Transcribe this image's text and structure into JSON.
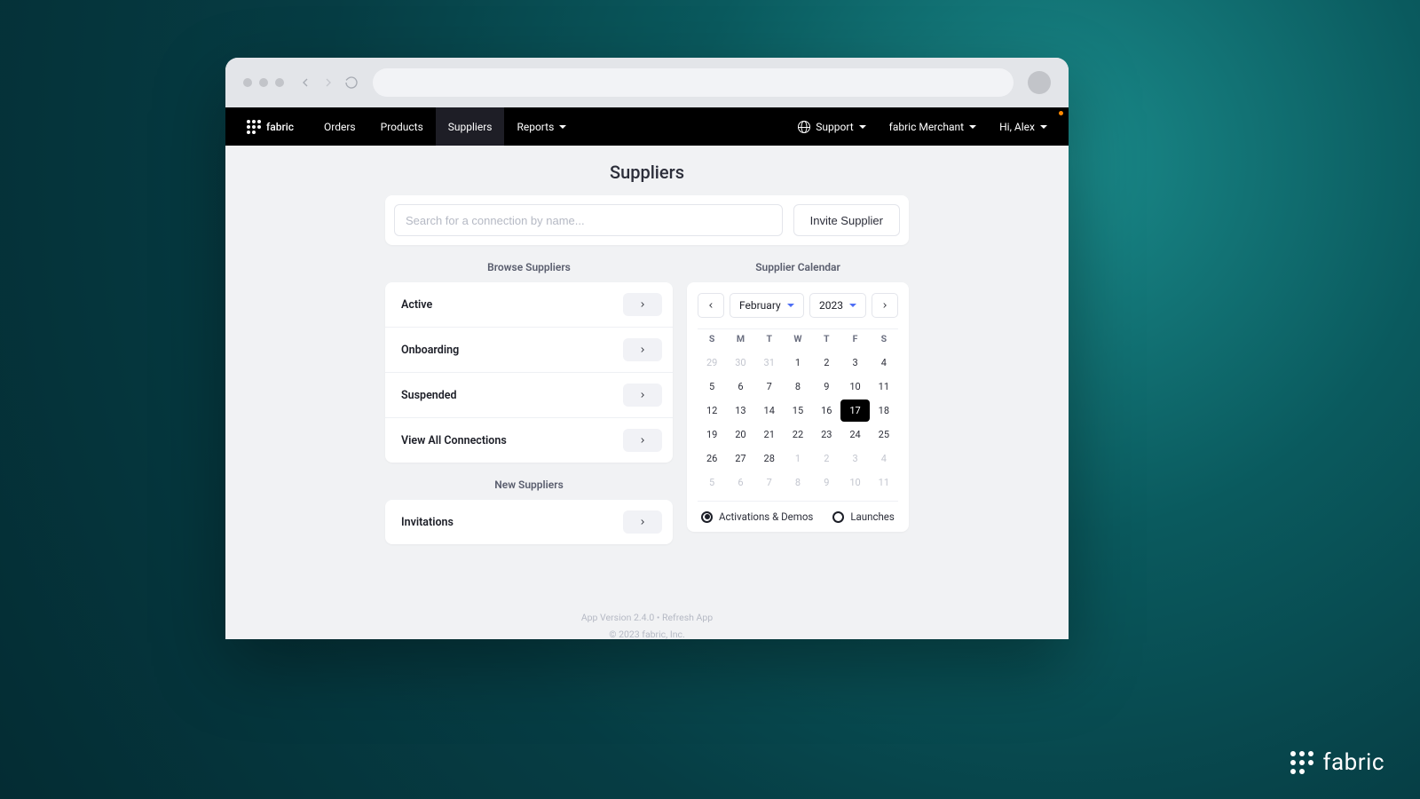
{
  "brand": "fabric",
  "nav": {
    "links": [
      "Orders",
      "Products",
      "Suppliers",
      "Reports"
    ],
    "active_index": 2,
    "dropdown_index": 3
  },
  "rightnav": {
    "support": "Support",
    "tenant": "fabric Merchant",
    "greeting": "Hi, Alex"
  },
  "page": {
    "title": "Suppliers"
  },
  "search": {
    "placeholder": "Search for a connection by name...",
    "invite_label": "Invite Supplier"
  },
  "browse": {
    "heading": "Browse Suppliers",
    "items": [
      "Active",
      "Onboarding",
      "Suspended",
      "View All Connections"
    ]
  },
  "new_suppliers": {
    "heading": "New Suppliers",
    "items": [
      "Invitations"
    ]
  },
  "calendar": {
    "heading": "Supplier Calendar",
    "month_label": "February",
    "year_label": "2023",
    "dayheaders": [
      "S",
      "M",
      "T",
      "W",
      "T",
      "F",
      "S"
    ],
    "selected_day": 17,
    "leading_other": [
      29,
      30,
      31
    ],
    "days_in_month": 28,
    "trailing_other": [
      1,
      2,
      3,
      4,
      5,
      6,
      7,
      8,
      9,
      10,
      11
    ],
    "legend": {
      "a": "Activations & Demos",
      "b": "Launches",
      "selected": "a"
    }
  },
  "footer": {
    "line1": "App Version 2.4.0 • Refresh App",
    "line2": "© 2023 fabric, Inc."
  },
  "watermark": "fabric"
}
